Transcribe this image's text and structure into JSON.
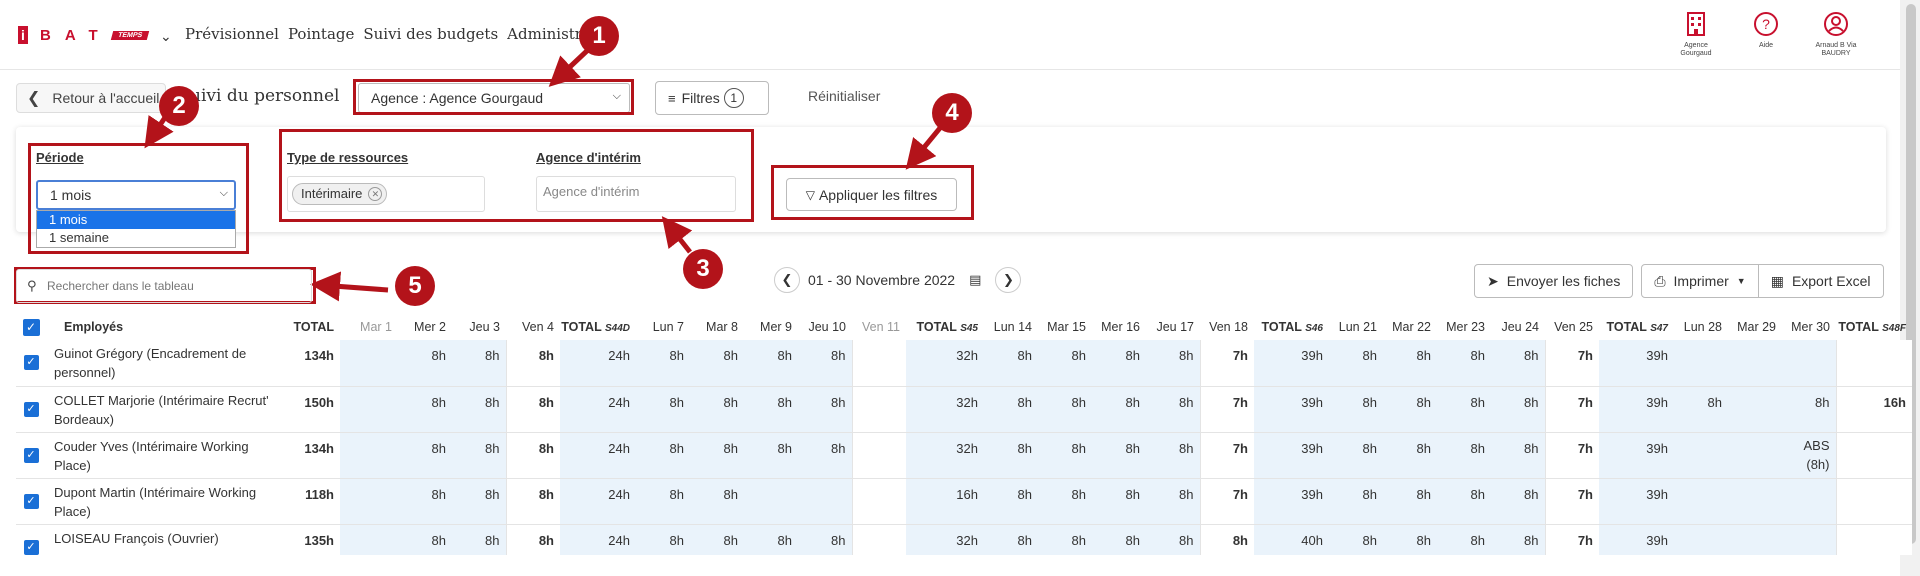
{
  "brand": {
    "logo_i": "i",
    "logo_letters": "BAT",
    "logo_tag": "TEMPS"
  },
  "nav": [
    "Prévisionnel",
    "Pointage",
    "Suivi des budgets",
    "Administrer"
  ],
  "top_icons": [
    {
      "icon": "building-icon",
      "label": "Agence Gourgaud"
    },
    {
      "icon": "help-icon",
      "label": "Aide"
    },
    {
      "icon": "user-icon",
      "label": "Arnaud B Via BAUDRY"
    }
  ],
  "toolbar": {
    "back_label": "Retour à l'accueil",
    "page_title": "uivi du personnel",
    "agency_select": "Agence : Agence Gourgaud",
    "filters_label": "Filtres",
    "filters_count": "1",
    "reset_label": "Réinitialiser"
  },
  "filters": {
    "period_label": "Période",
    "period_value": "1 mois",
    "period_options": [
      "1 mois",
      "1 semaine"
    ],
    "resource_label": "Type de ressources",
    "resource_chip": "Intérimaire",
    "interim_label": "Agence d'intérim",
    "interim_placeholder": "Agence d'intérim",
    "apply_label": "Appliquer les filtres"
  },
  "annotations": [
    "1",
    "2",
    "3",
    "4",
    "5"
  ],
  "search_placeholder": "Rechercher dans le tableau",
  "date_range": "01 - 30 Novembre 2022",
  "actions": {
    "send": "Envoyer les fiches",
    "print": "Imprimer",
    "export": "Export Excel"
  },
  "table": {
    "headers": [
      "Employés",
      "TOTAL",
      "Mar 1",
      "Mer 2",
      "Jeu 3",
      "Ven 4",
      "TOTAL",
      "Lun 7",
      "Mar 8",
      "Mer 9",
      "Jeu 10",
      "Ven 11",
      "TOTAL",
      "Lun 14",
      "Mar 15",
      "Mer 16",
      "Jeu 17",
      "Ven 18",
      "TOTAL",
      "Lun 21",
      "Mar 22",
      "Mer 23",
      "Jeu 24",
      "Ven 25",
      "TOTAL",
      "Lun 28",
      "Mar 29",
      "Mer 30",
      "TOTAL"
    ],
    "week_tags": [
      "S44D",
      "S45",
      "S46",
      "S47",
      "S48F"
    ],
    "rows": [
      {
        "name": "Guinot Grégory (Encadrement de personnel)",
        "cells": [
          "134h",
          "",
          "8h",
          "8h",
          "8h",
          "24h",
          "8h",
          "8h",
          "8h",
          "8h",
          "",
          "32h",
          "8h",
          "8h",
          "8h",
          "8h",
          "7h",
          "39h",
          "8h",
          "8h",
          "8h",
          "8h",
          "7h",
          "39h",
          "",
          "",
          "",
          ""
        ]
      },
      {
        "name": "COLLET Marjorie (Intérimaire Recrut' Bordeaux)",
        "cells": [
          "150h",
          "",
          "8h",
          "8h",
          "8h",
          "24h",
          "8h",
          "8h",
          "8h",
          "8h",
          "",
          "32h",
          "8h",
          "8h",
          "8h",
          "8h",
          "7h",
          "39h",
          "8h",
          "8h",
          "8h",
          "8h",
          "7h",
          "39h",
          "8h",
          "",
          "8h",
          "16h"
        ]
      },
      {
        "name": "Couder Yves (Intérimaire Working Place)",
        "cells": [
          "134h",
          "",
          "8h",
          "8h",
          "8h",
          "24h",
          "8h",
          "8h",
          "8h",
          "8h",
          "",
          "32h",
          "8h",
          "8h",
          "8h",
          "8h",
          "7h",
          "39h",
          "8h",
          "8h",
          "8h",
          "8h",
          "7h",
          "39h",
          "",
          "",
          "ABS (8h)",
          ""
        ]
      },
      {
        "name": "Dupont Martin (Intérimaire Working Place)",
        "cells": [
          "118h",
          "",
          "8h",
          "8h",
          "8h",
          "24h",
          "8h",
          "8h",
          "",
          "",
          "",
          "16h",
          "8h",
          "8h",
          "8h",
          "8h",
          "7h",
          "39h",
          "8h",
          "8h",
          "8h",
          "8h",
          "7h",
          "39h",
          "",
          "",
          "",
          ""
        ]
      },
      {
        "name": "LOISEAU François (Ouvrier)",
        "cells": [
          "135h",
          "",
          "8h",
          "8h",
          "8h",
          "24h",
          "8h",
          "8h",
          "8h",
          "8h",
          "",
          "32h",
          "8h",
          "8h",
          "8h",
          "8h",
          "8h",
          "40h",
          "8h",
          "8h",
          "8h",
          "8h",
          "7h",
          "39h",
          "",
          "",
          "",
          ""
        ]
      }
    ]
  },
  "colors": {
    "brand_red": "#c8102e",
    "annotation_red": "#b3131a",
    "checkbox_blue": "#1a6fd6",
    "over_hours": "#e8702a"
  }
}
